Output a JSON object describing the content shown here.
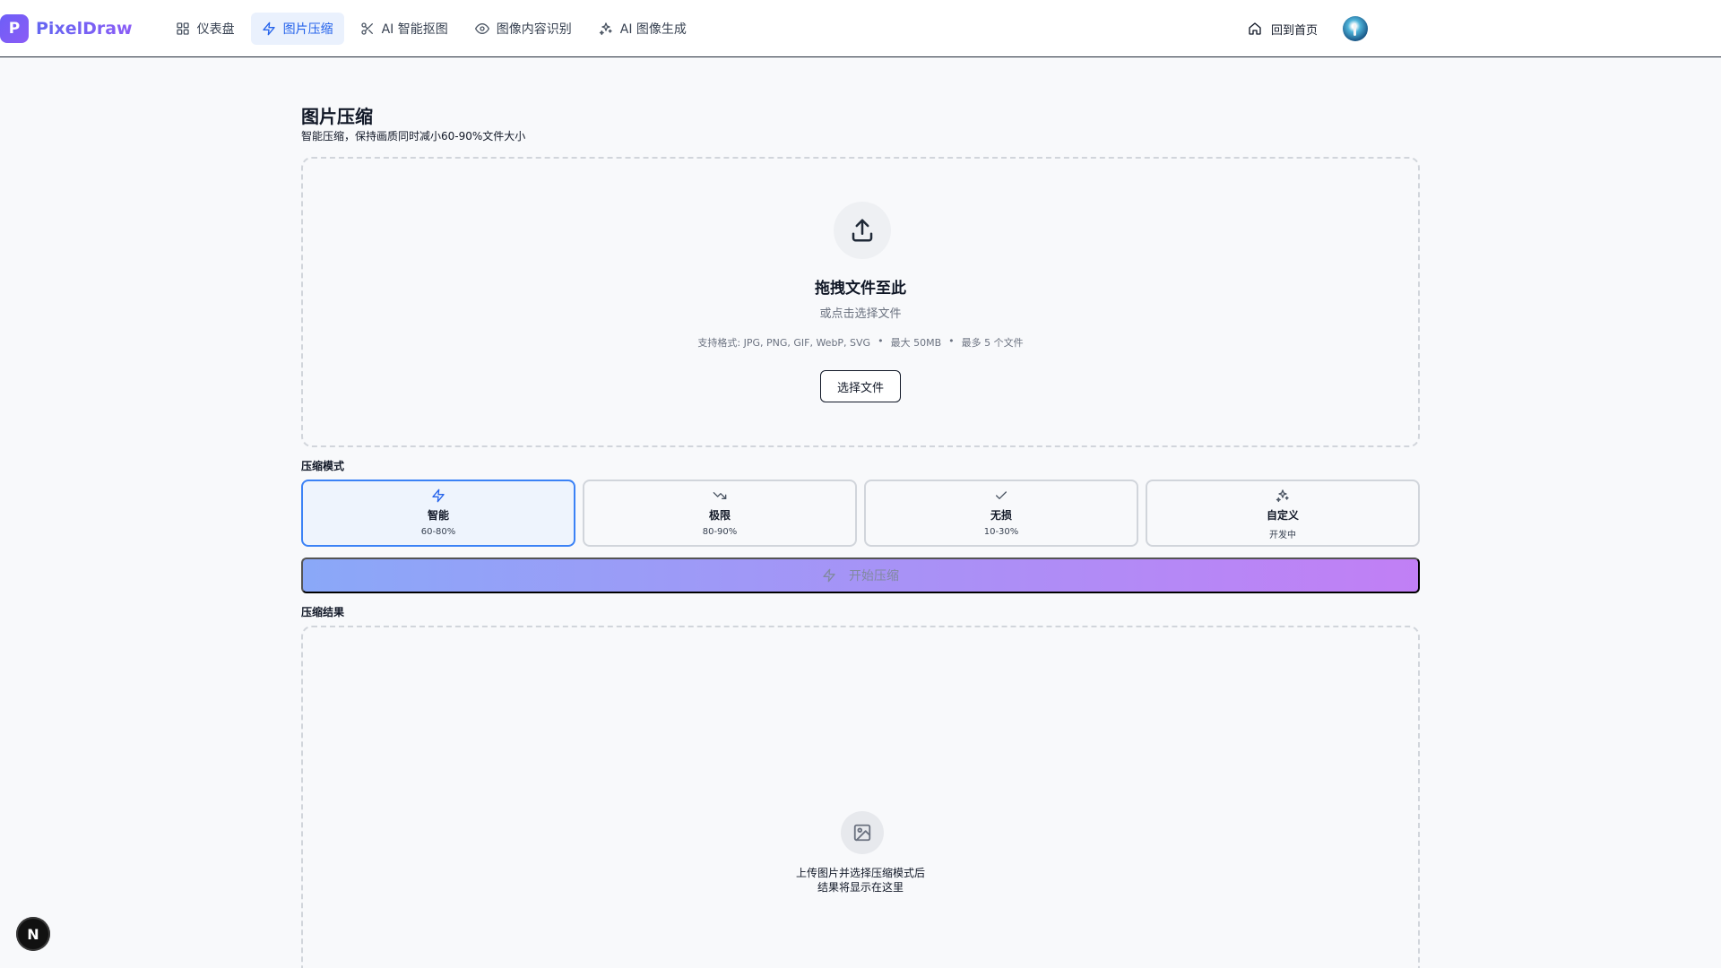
{
  "brand": {
    "logo_letter": "P",
    "name": "PixelDraw"
  },
  "nav": {
    "items": [
      {
        "label": "仪表盘",
        "icon": "dashboard-icon"
      },
      {
        "label": "图片压缩",
        "icon": "zap-icon",
        "active": true
      },
      {
        "label": "AI 智能抠图",
        "icon": "scissors-icon"
      },
      {
        "label": "图像内容识别",
        "icon": "eye-icon"
      },
      {
        "label": "AI 图像生成",
        "icon": "sparkles-icon"
      }
    ],
    "home_label": "回到首页"
  },
  "page": {
    "title": "图片压缩",
    "subtitle": "智能压缩，保持画质同时减小60-90%文件大小"
  },
  "dropzone": {
    "title": "拖拽文件至此",
    "subtitle": "或点击选择文件",
    "formats": "支持格式: JPG, PNG, GIF, WebP, SVG",
    "max_size": "最大 50MB",
    "max_files": "最多 5 个文件",
    "separator": "•",
    "button": "选择文件"
  },
  "modes": {
    "label": "压缩模式",
    "items": [
      {
        "name": "智能",
        "range": "60-80%",
        "icon": "zap-icon",
        "selected": true
      },
      {
        "name": "极限",
        "range": "80-90%",
        "icon": "trending-down-icon"
      },
      {
        "name": "无损",
        "range": "10-30%",
        "icon": "check-icon"
      },
      {
        "name": "自定义",
        "range": "开发中",
        "icon": "sparkles-icon"
      }
    ]
  },
  "start_button": "开始压缩",
  "results": {
    "label": "压缩结果",
    "empty_line1": "上传图片并选择压缩模式后",
    "empty_line2": "结果将显示在这里"
  },
  "floating_badge": "N",
  "colors": {
    "accent": "#2563eb",
    "brand": "#7c3aed",
    "active_nav_bg": "#eaf1fd"
  }
}
